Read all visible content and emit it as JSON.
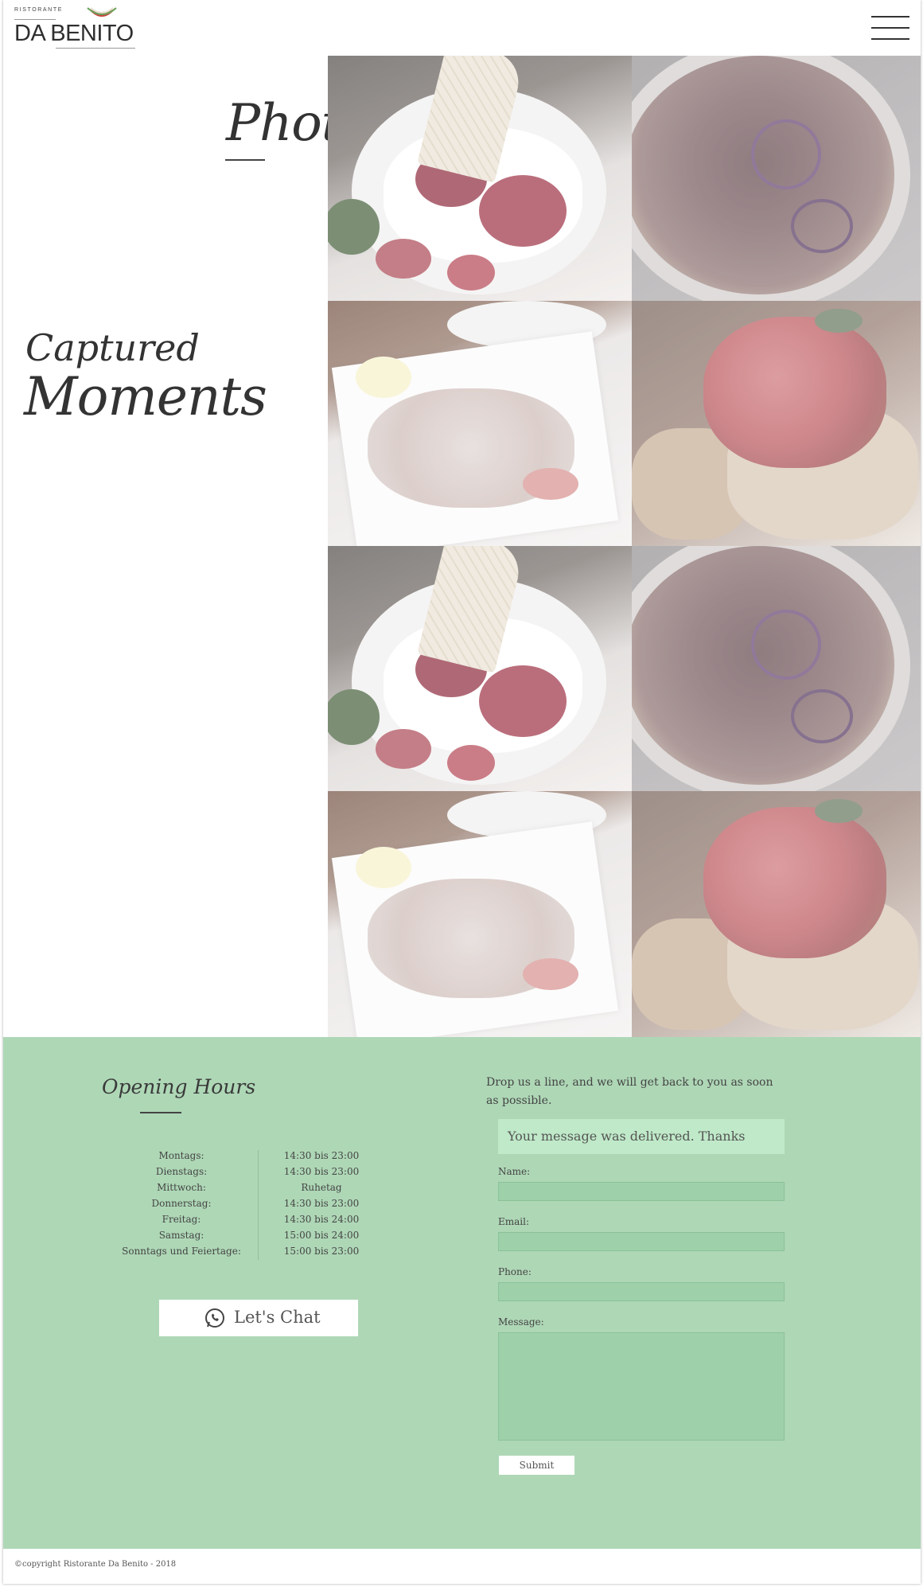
{
  "header": {
    "logo_small": "RISTORANTE",
    "logo_name": "DA BENITO",
    "menu_icon": "hamburger-menu-icon"
  },
  "photos": {
    "title": "Photos",
    "subtitle_line1": "Captured",
    "subtitle_line2": "Moments",
    "tiles": [
      {
        "subject": "dessert"
      },
      {
        "subject": "pizza"
      },
      {
        "subject": "fish"
      },
      {
        "subject": "bruschetta"
      },
      {
        "subject": "dessert"
      },
      {
        "subject": "pizza"
      },
      {
        "subject": "fish"
      },
      {
        "subject": "bruschetta"
      }
    ]
  },
  "opening_hours": {
    "title": "Opening Hours",
    "rows": [
      {
        "day": "Montags:",
        "time": "14:30 bis 23:00"
      },
      {
        "day": "Dienstags:",
        "time": "14:30 bis 23:00"
      },
      {
        "day": "Mittwoch:",
        "time": "Ruhetag"
      },
      {
        "day": "Donnerstag:",
        "time": "14:30 bis 23:00"
      },
      {
        "day": "Freitag:",
        "time": "14:30 bis 24:00"
      },
      {
        "day": "Samstag:",
        "time": "15:00 bis 24:00"
      },
      {
        "day": "Sonntags und Feiertage:",
        "time": "15:00 bis 23:00"
      }
    ],
    "chat_label": "Let's Chat",
    "chat_icon": "whatsapp-icon"
  },
  "contact": {
    "intro": "Drop us a line, and we will get back to you as soon as possible.",
    "success": "Your message was delivered. Thanks",
    "name_label": "Name:",
    "name_value": "",
    "email_label": "Email:",
    "email_value": "",
    "phone_label": "Phone:",
    "phone_value": "",
    "message_label": "Message:",
    "message_value": "",
    "submit_label": "Submit"
  },
  "footer": {
    "copyright": "©copyright Ristorante Da Benito - 2018"
  },
  "colors": {
    "green_section": "#aed7b6",
    "input_bg": "#9ed1a9",
    "success_bg": "#bfe9c8"
  }
}
